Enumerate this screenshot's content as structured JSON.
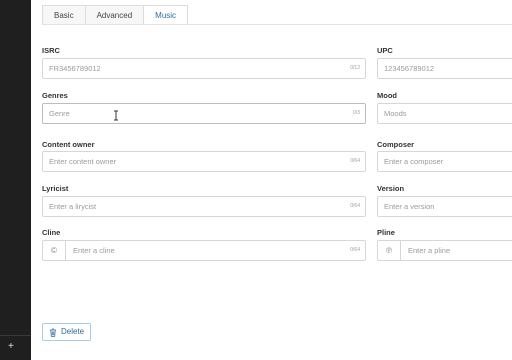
{
  "tabs": [
    {
      "label": "Basic",
      "active": false
    },
    {
      "label": "Advanced",
      "active": false
    },
    {
      "label": "Music",
      "active": true
    }
  ],
  "fields": {
    "isrc": {
      "label": "ISRC",
      "placeholder": "FR3456789012",
      "counter": "0/12"
    },
    "upc": {
      "label": "UPC",
      "placeholder": "123456789012"
    },
    "genres": {
      "label": "Genres",
      "placeholder": "Genre",
      "counter": "0/3"
    },
    "mood": {
      "label": "Mood",
      "placeholder": "Moods"
    },
    "content_owner": {
      "label": "Content owner",
      "placeholder": "Enter content owner",
      "counter": "0/64"
    },
    "composer": {
      "label": "Composer",
      "placeholder": "Enter a composer"
    },
    "lyricist": {
      "label": "Lyricist",
      "placeholder": "Enter a lirycist",
      "counter": "0/64"
    },
    "version": {
      "label": "Version",
      "placeholder": "Enter a version"
    },
    "cline": {
      "label": "Cline",
      "prefix": "©",
      "placeholder": "Enter a cline",
      "counter": "0/64"
    },
    "pline": {
      "label": "Pline",
      "prefix": "℗",
      "placeholder": "Enter a pline"
    }
  },
  "actions": {
    "delete_label": "Delete"
  },
  "rail": {
    "add_symbol": "+"
  },
  "colors": {
    "accent": "#2e6b9e",
    "rail": "#1f1f1f",
    "border": "#d7d7d7"
  },
  "icons": {
    "delete": "trash-icon",
    "cursor": "text-cursor-icon"
  }
}
